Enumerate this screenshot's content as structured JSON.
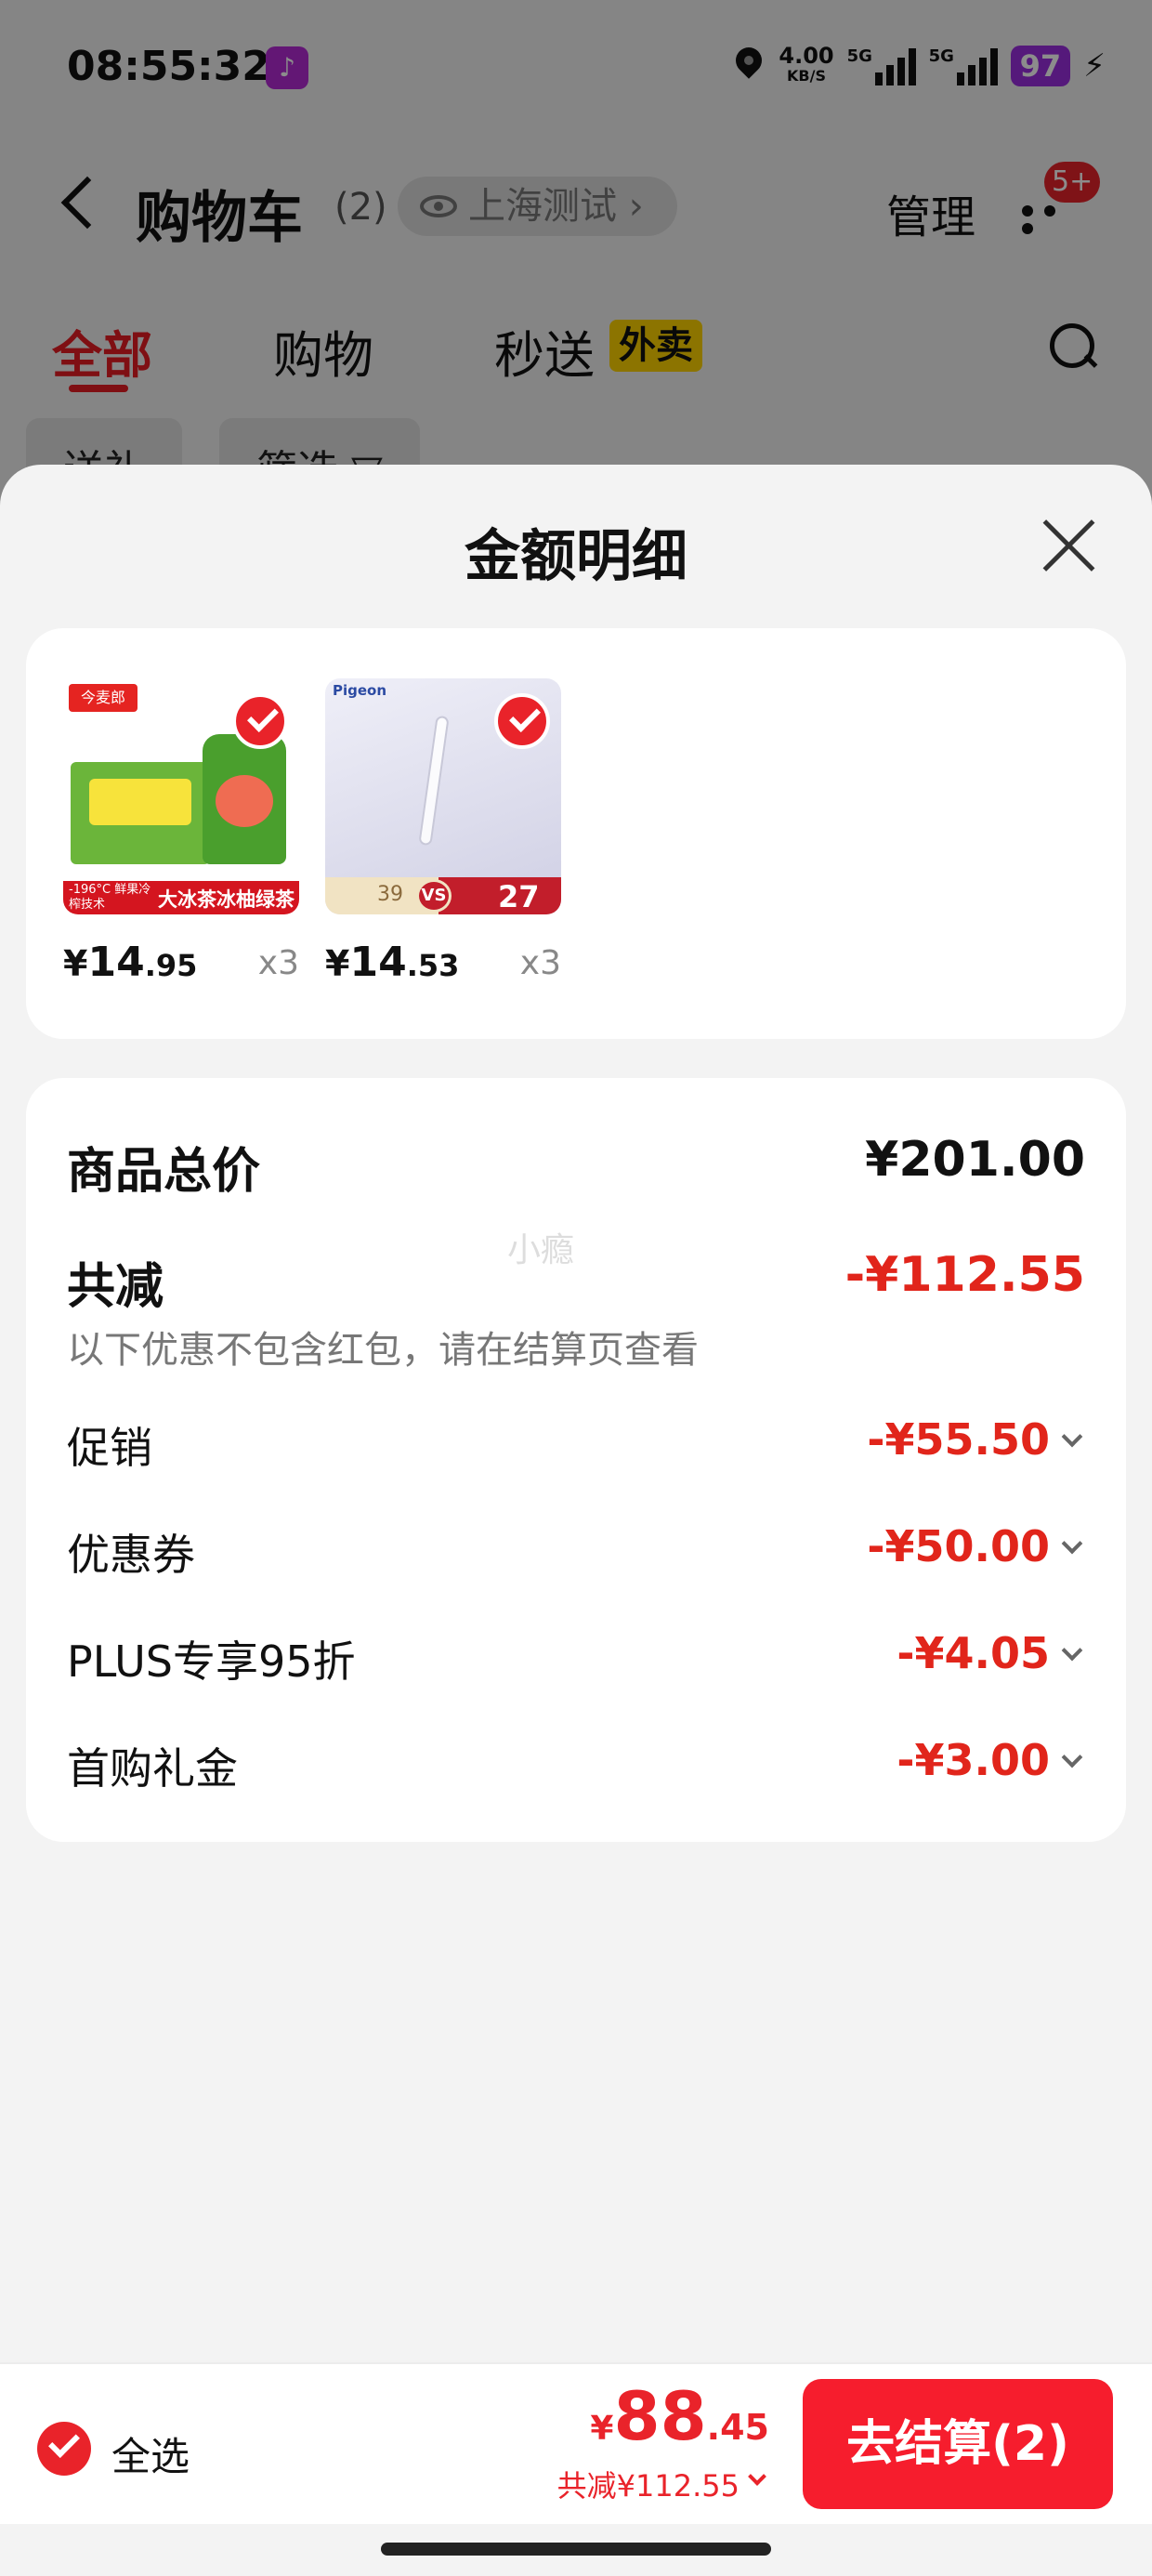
{
  "status_bar": {
    "time": "08:55:32",
    "net_speed": "4.00",
    "net_unit": "KB/S",
    "signal_1": "5G",
    "signal_2": "5G",
    "battery": "97"
  },
  "nav": {
    "title": "购物车",
    "count": "(2)",
    "location": "上海测试",
    "location_chevron": "›",
    "manage": "管理",
    "message_badge": "5+"
  },
  "tabs": [
    {
      "label": "全部",
      "active": true
    },
    {
      "label": "购物"
    },
    {
      "label": "秒送",
      "tag": "外卖"
    }
  ],
  "filters": [
    "送礼",
    "筛选 ▽"
  ],
  "sheet": {
    "title": "金额明细"
  },
  "products": [
    {
      "name": "大冰茶冰柚绿茶",
      "brand": "今麦郎",
      "strip_small": "-196°C 鲜果冷榨技术",
      "yen": "¥",
      "price_int": "14",
      "price_dec": ".95",
      "qty": "x3",
      "selected": true
    },
    {
      "name": "pigeon straw",
      "brand": "Pigeon",
      "compare_low": "39",
      "compare_vs": "VS",
      "compare_high": "27",
      "yen": "¥",
      "price_int": "14",
      "price_dec": ".53",
      "qty": "x3",
      "selected": true
    }
  ],
  "details": {
    "total_label": "商品总价",
    "total_value": "¥201.00",
    "discount_label": "共减",
    "discount_value": "-¥112.55",
    "discount_note": "以下优惠不包含红包，请在结算页查看",
    "watermark": "小瘾",
    "items": [
      {
        "label": "促销",
        "value": "-¥55.50"
      },
      {
        "label": "优惠券",
        "value": "-¥50.00"
      },
      {
        "label": "PLUS专享95折",
        "value": "-¥4.05"
      },
      {
        "label": "首购礼金",
        "value": "-¥3.00"
      }
    ]
  },
  "checkout": {
    "select_all": "全选",
    "yen": "¥",
    "total_int": "88",
    "total_dec": ".45",
    "saving": "共减¥112.55",
    "button": "去结算(2)"
  },
  "colors": {
    "accent_red": "#e9232a",
    "checkout_button": "#f61d2d",
    "discount_text": "#e1251b",
    "flash_tag": "#ffd400"
  },
  "icons": [
    "back-chevron-icon",
    "eye-icon",
    "more-icon",
    "search-icon",
    "close-icon",
    "check-icon",
    "chevron-down-icon",
    "bell-icon",
    "location-icon"
  ]
}
